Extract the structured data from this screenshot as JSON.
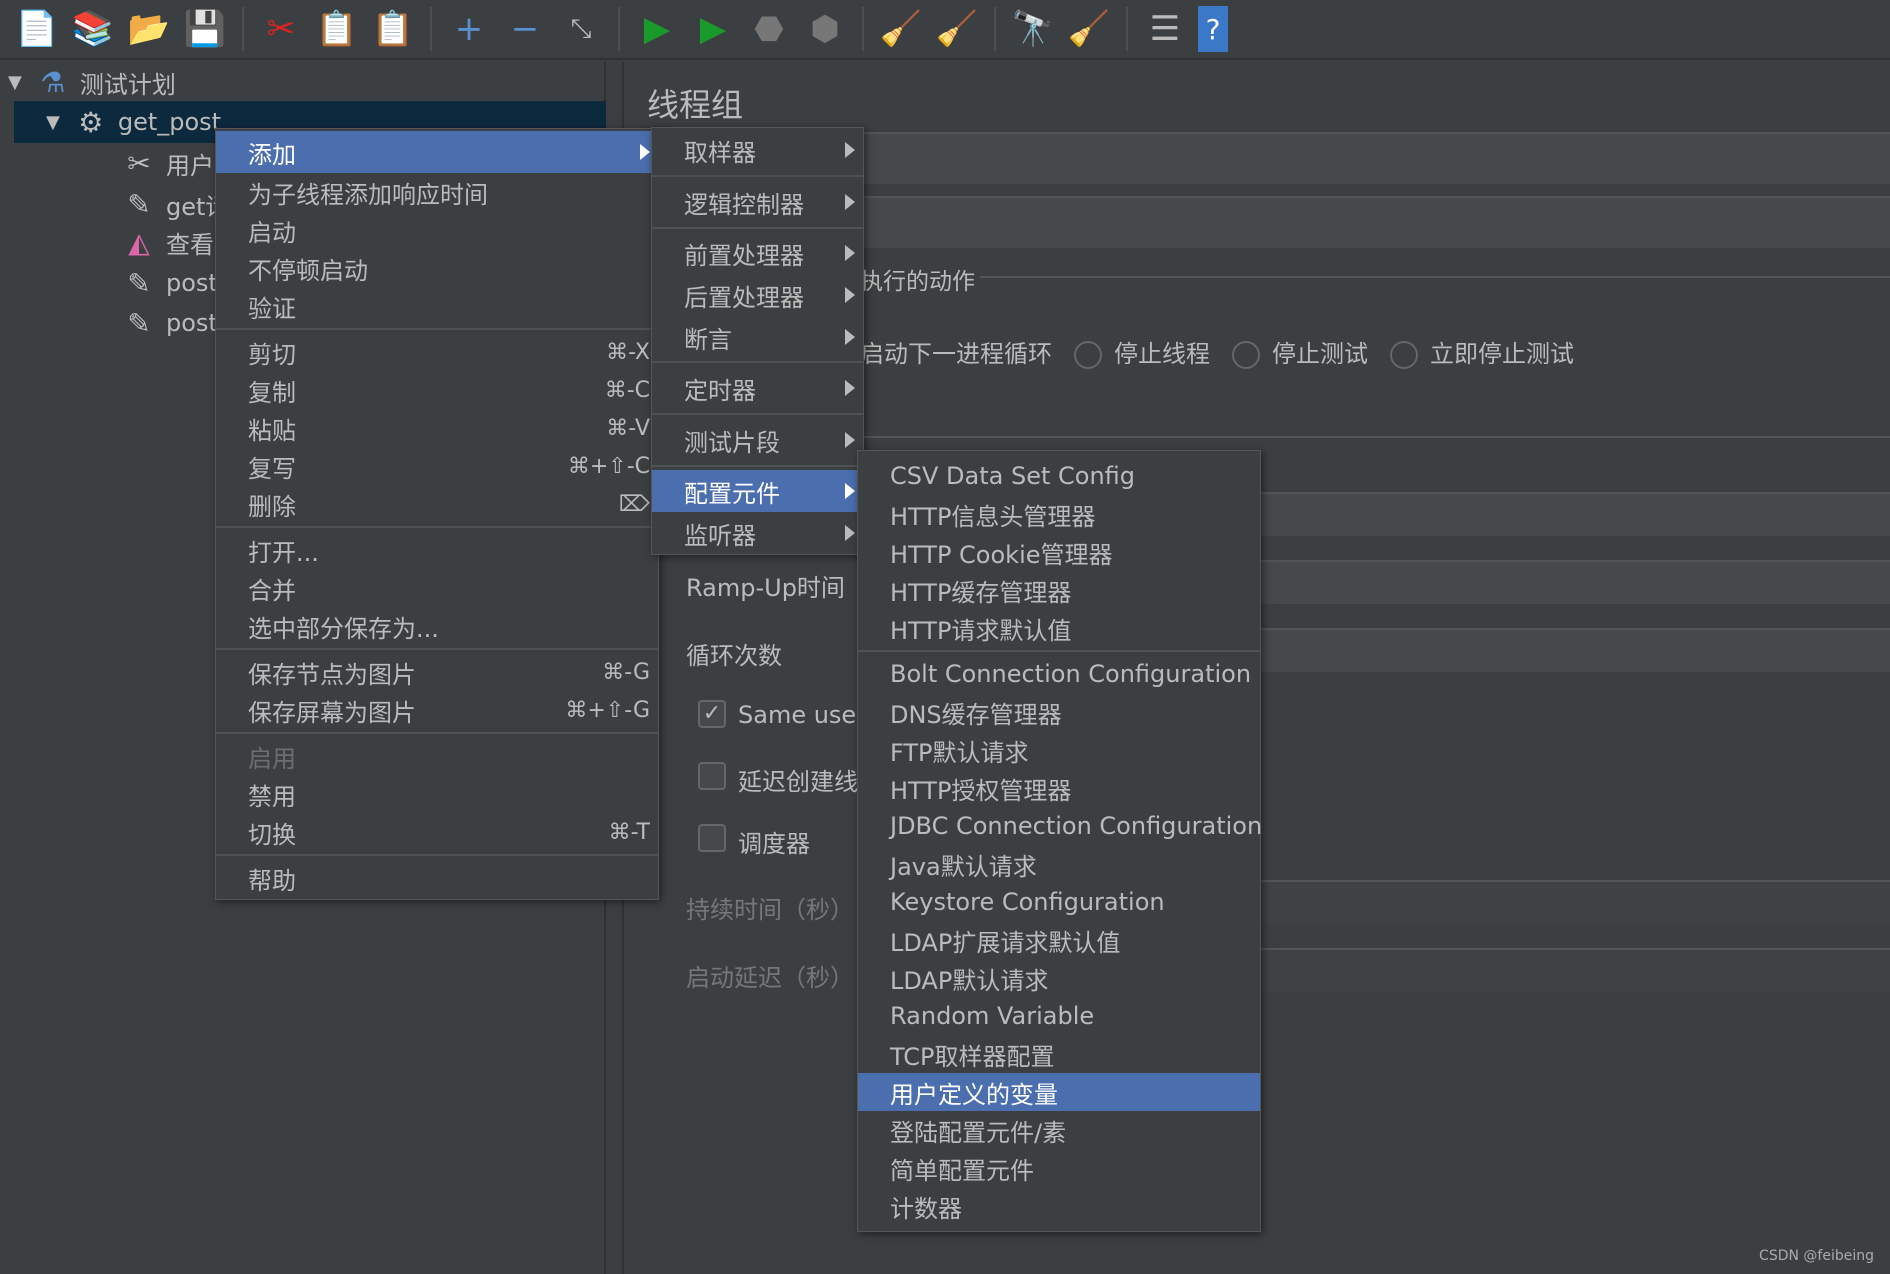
{
  "toolbar": {
    "icons": [
      "new-icon",
      "templates-icon",
      "open-icon",
      "save-icon",
      "cut-icon",
      "copy-icon",
      "paste-icon",
      "expand-icon",
      "collapse-icon",
      "toggle-icon",
      "start-icon",
      "start-no-pause-icon",
      "stop-icon",
      "shutdown-icon",
      "clear-icon",
      "clear-all-icon",
      "search-icon",
      "reset-search-icon",
      "function-helper-icon",
      "help-icon"
    ]
  },
  "tree": {
    "root": "测试计划",
    "selected": "get_post",
    "children": [
      "用户",
      "get请",
      "查看",
      "post",
      "post"
    ]
  },
  "main": {
    "title": "线程组",
    "action_label": "执行的动作",
    "radio_partial": "启动下一进程循环",
    "radios": [
      "停止线程",
      "停止测试",
      "立即停止测试"
    ],
    "rampup": "Ramp-Up时间（",
    "loop": "循环次数",
    "same_user": "Same user",
    "delay": "延迟创建线",
    "scheduler": "调度器",
    "duration": "持续时间（秒）",
    "startup_delay": "启动延迟（秒）"
  },
  "menu1": {
    "add": "添加",
    "group1": [
      "为子线程添加响应时间",
      "启动",
      "不停顿启动",
      "验证"
    ],
    "edit": [
      {
        "label": "剪切",
        "sc": "⌘-X"
      },
      {
        "label": "复制",
        "sc": "⌘-C"
      },
      {
        "label": "粘贴",
        "sc": "⌘-V"
      },
      {
        "label": "复写",
        "sc": "⌘+⇧-C"
      },
      {
        "label": "删除",
        "sc": "⌦"
      }
    ],
    "file": [
      "打开...",
      "合并",
      "选中部分保存为..."
    ],
    "img": [
      {
        "label": "保存节点为图片",
        "sc": "⌘-G"
      },
      {
        "label": "保存屏幕为图片",
        "sc": "⌘+⇧-G"
      }
    ],
    "state": [
      {
        "label": "启用",
        "sc": ""
      },
      {
        "label": "禁用",
        "sc": ""
      },
      {
        "label": "切换",
        "sc": "⌘-T"
      }
    ],
    "help": "帮助"
  },
  "menu2": {
    "items": [
      "取样器",
      "逻辑控制器",
      "前置处理器",
      "后置处理器",
      "断言",
      "定时器",
      "测试片段",
      "配置元件",
      "监听器"
    ],
    "selected": "配置元件"
  },
  "menu3": {
    "group1": [
      "CSV Data Set Config",
      "HTTP信息头管理器",
      "HTTP Cookie管理器",
      "HTTP缓存管理器",
      "HTTP请求默认值"
    ],
    "group2": [
      "Bolt Connection Configuration",
      "DNS缓存管理器",
      "FTP默认请求",
      "HTTP授权管理器",
      "JDBC Connection Configuration",
      "Java默认请求",
      "Keystore Configuration",
      "LDAP扩展请求默认值",
      "LDAP默认请求",
      "Random Variable",
      "TCP取样器配置",
      "用户定义的变量",
      "登陆配置元件/素",
      "简单配置元件",
      "计数器"
    ],
    "selected": "用户定义的变量"
  },
  "watermark": "CSDN @feibeing",
  "colors": {
    "background": "#3c3f41",
    "highlight": "#4b6eaf",
    "tree_selection": "#0d293e"
  }
}
